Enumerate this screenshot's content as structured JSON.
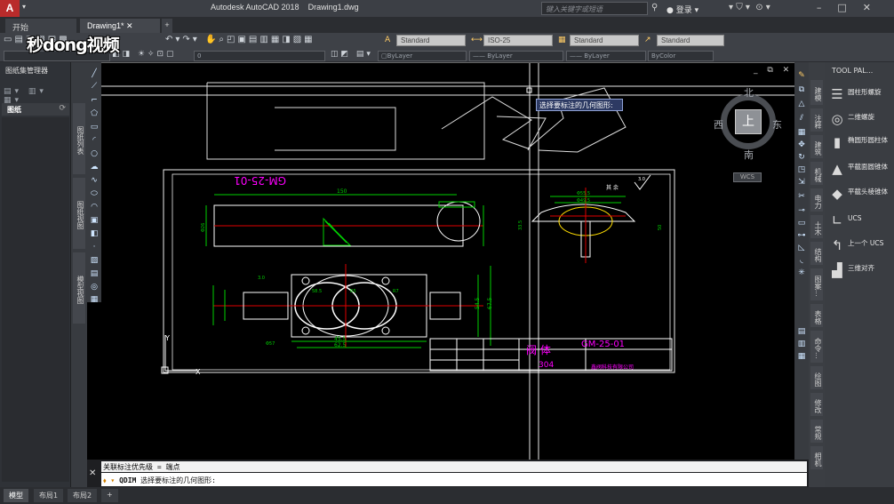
{
  "title": {
    "app": "Autodesk AutoCAD 2018",
    "doc": "Drawing1.dwg"
  },
  "search": {
    "placeholder": "键入关键字或短语"
  },
  "account": {
    "login": "登录"
  },
  "tabs": [
    {
      "label": "开始"
    },
    {
      "label": "Drawing1*"
    },
    {
      "label": "+"
    }
  ],
  "styles": {
    "text": "Standard",
    "dim": "ISO-25",
    "table": "Standard",
    "mleader": "Standard"
  },
  "layer": {
    "name": "0"
  },
  "props": {
    "color": "ByLayer",
    "linetype": "ByLayer",
    "lineweight": "ByLayer",
    "plotstyle": "ByColor"
  },
  "watermark": "秒dong视频",
  "left_panel": {
    "title": "图纸集管理器",
    "header": "图纸",
    "vtabs": [
      "图纸列表",
      "图纸视图",
      "模型视图"
    ]
  },
  "tooltip": "选择要标注的几何图形:",
  "viewcube": {
    "north": "北",
    "south": "南",
    "east": "东",
    "west": "西",
    "face": "上",
    "ucs": "WCS"
  },
  "tool_palette": {
    "title": "TOOL PAL...",
    "items": [
      {
        "label": "圆柱形螺旋"
      },
      {
        "label": "二维螺旋"
      },
      {
        "label": "椭圆形圆柱体"
      },
      {
        "label": "平截面圆锥体"
      },
      {
        "label": "平截头棱锥体"
      },
      {
        "label": "UCS"
      },
      {
        "label": "上一个 UCS"
      },
      {
        "label": "三维对齐"
      }
    ],
    "vtabs": [
      "建模",
      "注释",
      "建筑",
      "机械",
      "电力",
      "土木",
      "结构",
      "图案...",
      "表格",
      "命令...",
      "绘图",
      "修改",
      "常规",
      "相机"
    ]
  },
  "command": {
    "history": "关联标注优先级 = 端点",
    "prompt_kw": "QDIM",
    "prompt_text": "选择要标注的几何图形:"
  },
  "layout_tabs": [
    {
      "label": "模型"
    },
    {
      "label": "布局1"
    },
    {
      "label": "布局2"
    },
    {
      "label": "+"
    }
  ],
  "drawing": {
    "title_block_name": "阀 体",
    "drawing_no": "GM-25-01",
    "drawing_no_mirror": "GM-25-01",
    "dim_150": "150",
    "dim_545": "54.5",
    "dim_675": "67.5",
    "dim_455": "45.5",
    "dim_625": "62.5",
    "dim_r5": "R5",
    "dim_r7": "R7",
    "dim_585": "58.5",
    "dim_57": "Φ57",
    "dim_555": "Φ55.5",
    "dim_495": "Φ49.5",
    "dim_26": "Φ26",
    "dim_50": "50",
    "dim_335": "33.5",
    "dim_3": "3.0",
    "material": "304",
    "company": "鑫阀科技有限公司",
    "ys": "其 余",
    "ucs_y": "Y",
    "ucs_x": "X"
  },
  "colors": {
    "accent": "#b92b2b",
    "dim_green": "#00d000",
    "center_red": "#e00000",
    "magenta": "#ff00ff",
    "cyan": "#00d8ff"
  }
}
